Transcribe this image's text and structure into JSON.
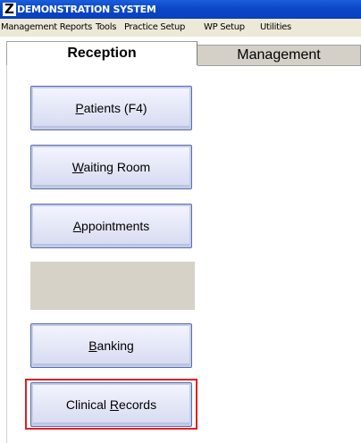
{
  "window": {
    "title": "DEMONSTRATION SYSTEM",
    "icon_glyph": "Z"
  },
  "menu": {
    "items": [
      "Management Reports",
      "Tools",
      "Practice Setup",
      "WP Setup",
      "Utilities"
    ]
  },
  "tabs": [
    {
      "label": "Reception",
      "active": true
    },
    {
      "label": "Management",
      "active": false
    }
  ],
  "buttons": [
    {
      "pre": "",
      "key": "P",
      "post": "atients (F4)"
    },
    {
      "pre": "",
      "key": "W",
      "post": "aiting Room"
    },
    {
      "pre": "",
      "key": "A",
      "post": "ppointments"
    },
    {
      "pre": "",
      "key": "B",
      "post": "anking"
    },
    {
      "pre": "Clinical ",
      "key": "R",
      "post": "ecords"
    }
  ],
  "colors": {
    "titlebar": "#0b47c8",
    "menubar": "#ece9d8",
    "highlight": "#e02020"
  }
}
